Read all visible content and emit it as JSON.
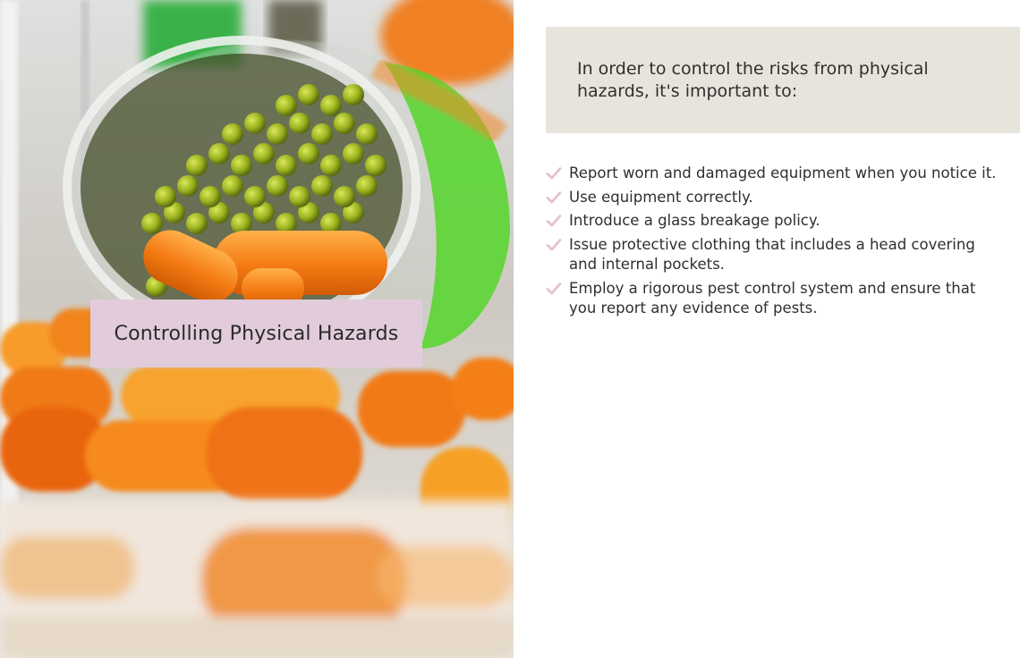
{
  "hero": {
    "image_alt": "jar of peas and carrots spilled",
    "title": "Controlling Physical Hazards"
  },
  "callout": {
    "text": "In order to control the risks from physical hazards, it's important to:"
  },
  "list": {
    "icon": "check-icon",
    "check_color": "#e2c1d3",
    "items": [
      "Report worn and damaged equipment when you notice it.",
      "Use equipment correctly.",
      "Introduce a glass breakage policy.",
      "Issue protective clothing that includes a head covering and internal pockets.",
      "Employ a rigorous pest control system and ensure that you report any evidence of pests."
    ]
  },
  "colors": {
    "title_box": "#e2ccdb",
    "callout_bg": "#e7e4db",
    "text": "#2f2f2f"
  }
}
